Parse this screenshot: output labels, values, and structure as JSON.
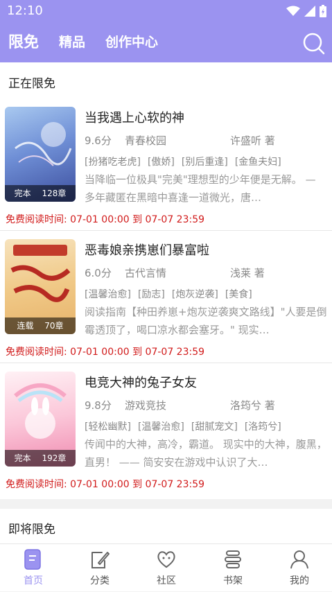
{
  "status": {
    "time": "12:10",
    "icons": [
      "wifi-icon",
      "signal-icon",
      "battery-icon"
    ]
  },
  "header": {
    "tabs": [
      {
        "label": "限免",
        "active": true
      },
      {
        "label": "精品",
        "active": false
      },
      {
        "label": "创作中心",
        "active": false
      }
    ],
    "search_icon": "search-icon"
  },
  "sections": {
    "current_title": "正在限免",
    "upcoming_title": "即将限免"
  },
  "books": [
    {
      "title": "当我遇上心软的神",
      "score": "9.6分",
      "category": "青春校园",
      "author": "许盛听 著",
      "tags": [
        "[扮猪吃老虎]",
        "[傲娇]",
        "[别后重逢]",
        "[金鱼夫妇]"
      ],
      "description": "当降临一位极具\"完美\"理想型的少年便是无解。 — 多年藏匿在黑暗中喜逢一道微光，唐…",
      "status": "完本",
      "chapters": "128章",
      "free_time": "免费阅读时间: 07-01 00:00 到 07-07 23:59",
      "cover_colors": [
        "#8fb6e8",
        "#3d4f9e"
      ]
    },
    {
      "title": "恶毒娘亲携崽们暴富啦",
      "score": "6.0分",
      "category": "古代言情",
      "author": "浅莱 著",
      "tags": [
        "[温馨治愈]",
        "[励志]",
        "[炮灰逆袭]",
        "[美食]"
      ],
      "description": "阅读指南【种田养崽+炮灰逆袭爽文路线】\"人要是倒霉透顶了，喝口凉水都会塞牙。\" 现实…",
      "status": "连载",
      "chapters": "70章",
      "free_time": "免费阅读时间: 07-01 00:00 到 07-07 23:59",
      "cover_colors": [
        "#f4d9a8",
        "#c23b2b"
      ]
    },
    {
      "title": "电竞大神的兔子女友",
      "score": "9.8分",
      "category": "游戏竞技",
      "author": "洛筠兮 著",
      "tags": [
        "[轻松幽默]",
        "[温馨治愈]",
        "[甜腻宠文]",
        "[洛筠兮]"
      ],
      "description": "传闻中的大神，高冷，霸道。 现实中的大神，腹黑，直男！ —— 简安安在游戏中认识了大…",
      "status": "完本",
      "chapters": "192章",
      "free_time": "免费阅读时间: 07-01 00:00 到 07-07 23:59",
      "cover_colors": [
        "#fde2ea",
        "#f08bb0"
      ]
    }
  ],
  "bottom_nav": [
    {
      "label": "首页",
      "icon": "home-book-icon",
      "active": true
    },
    {
      "label": "分类",
      "icon": "category-pen-icon",
      "active": false
    },
    {
      "label": "社区",
      "icon": "community-heart-icon",
      "active": false
    },
    {
      "label": "书架",
      "icon": "bookshelf-icon",
      "active": false
    },
    {
      "label": "我的",
      "icon": "profile-icon",
      "active": false
    }
  ],
  "colors": {
    "accent": "#9b93f0",
    "free_time": "#d11a1a"
  }
}
